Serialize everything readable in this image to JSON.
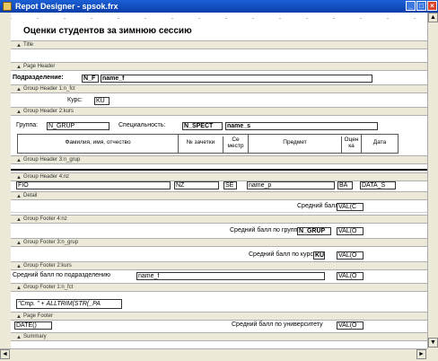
{
  "window": {
    "title": "Repot Designer - spsok.frx"
  },
  "bands": {
    "title": "Title",
    "page_header": "Page Header",
    "group_header_1": "Group Header 1:n_fct",
    "group_header_2": "Group Header 2:kurs",
    "group_header_3": "Group Header 3:n_grup",
    "group_header_4": "Group Header 4:nz",
    "detail": "Detail",
    "group_footer_4": "Group Footer 4:nz",
    "group_footer_3": "Group Footer 3:n_grup",
    "group_footer_2": "Group Footer 2:kurs",
    "group_footer_1": "Group Footer 1:n_fct",
    "page_footer": "Page Footer",
    "summary": "Summary"
  },
  "report": {
    "title_text": "Оценки студентов за зимнюю сессию",
    "dept_label": "Подразделение:",
    "dept_code_field": "N_F",
    "dept_name_field": "name_f",
    "course_label": "Курс:",
    "course_field": "KU",
    "group_label": "Группа:",
    "group_field": "N_GRUP",
    "spec_label": "Специальность:",
    "spec_field": "N_SPECT",
    "spec_name_field": "name_s",
    "columns": {
      "fio": "Фамилия, имя, отчество",
      "zachetka": "№ зачетки",
      "semestr_1": "Се",
      "semestr_2": "местр",
      "predmet": "Предмет",
      "ocenka_1": "Оцен",
      "ocenka_2": "ка",
      "data": "Дата"
    },
    "detail_fields": {
      "fio": "FIO",
      "nz": "NZ",
      "sem": "SE",
      "predmet": "name_p",
      "ball": "BA",
      "data": "DATA_S"
    },
    "avg_label": "Средний балл",
    "avg_field": "VAL(C",
    "avg_group_label": "Средний балл по группе",
    "avg_group_code": "N_GRUP",
    "avg_group_field": "VAL(O",
    "avg_course_label": "Средний балл по курсу",
    "avg_course_code": "KU",
    "avg_course_field": "VAL(O",
    "avg_dept_label": "Средний балл по подразделению",
    "avg_dept_name": "name_f",
    "avg_dept_field": "VAL(O",
    "page_footer_field": "\"Стр. \" + ALLTRIM(STR(_PA",
    "summary_field": "DATE()",
    "avg_univ_label": "Средний балл по университету",
    "avg_univ_field": "VAL(O"
  }
}
